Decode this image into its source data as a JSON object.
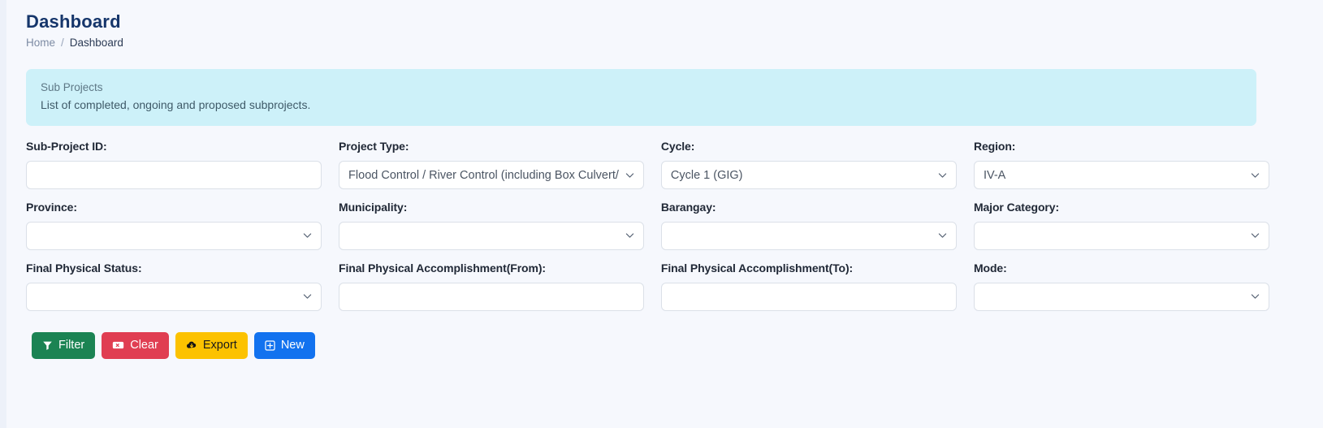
{
  "header": {
    "title": "Dashboard",
    "breadcrumb": {
      "home": "Home",
      "separator": "/",
      "current": "Dashboard"
    }
  },
  "banner": {
    "title": "Sub Projects",
    "subtitle": "List of completed, ongoing and proposed subprojects.",
    "background_color": "#cdf1f9"
  },
  "filters": {
    "fields": [
      {
        "label": "Sub-Project ID:",
        "type": "text",
        "value": "",
        "placeholder": ""
      },
      {
        "label": "Project Type:",
        "type": "select",
        "value": "Flood Control / River Control (including Box Culvert/"
      },
      {
        "label": "Cycle:",
        "type": "select",
        "value": "Cycle 1 (GIG)"
      },
      {
        "label": "Region:",
        "type": "select",
        "value": "IV-A"
      },
      {
        "label": "Province:",
        "type": "select",
        "value": ""
      },
      {
        "label": "Municipality:",
        "type": "select",
        "value": ""
      },
      {
        "label": "Barangay:",
        "type": "select",
        "value": ""
      },
      {
        "label": "Major Category:",
        "type": "select",
        "value": ""
      },
      {
        "label": "Final Physical Status:",
        "type": "select",
        "value": ""
      },
      {
        "label": "Final Physical Accomplishment(From):",
        "type": "text",
        "value": "",
        "placeholder": ""
      },
      {
        "label": "Final Physical Accomplishment(To):",
        "type": "text",
        "value": "",
        "placeholder": ""
      },
      {
        "label": "Mode:",
        "type": "select",
        "value": ""
      }
    ]
  },
  "actions": {
    "filter": {
      "label": "Filter",
      "icon": "funnel-icon",
      "color": "#1b8353"
    },
    "clear": {
      "label": "Clear",
      "icon": "eraser-icon",
      "color": "#e03e52"
    },
    "export": {
      "label": "Export",
      "icon": "cloud-download-icon",
      "color": "#fcc200"
    },
    "new": {
      "label": "New",
      "icon": "plus-square-icon",
      "color": "#1272ef"
    }
  }
}
